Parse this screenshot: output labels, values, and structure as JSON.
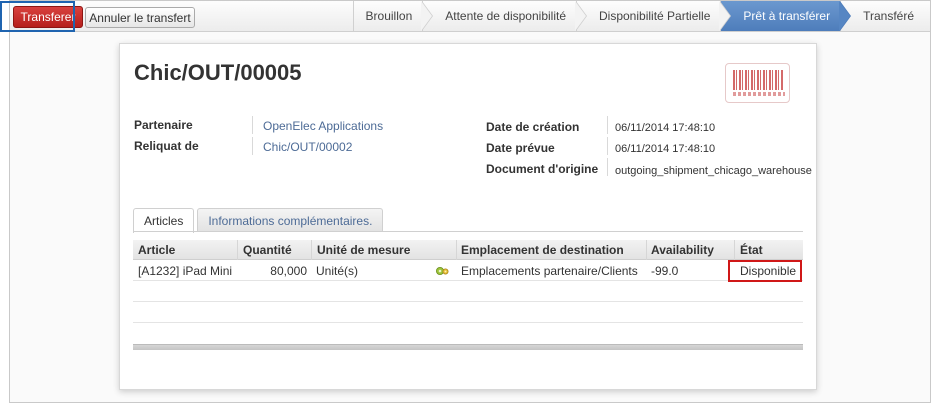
{
  "toolbar": {
    "transfer_label": "Transferer",
    "cancel_label": "Annuler le transfert"
  },
  "status_stages": [
    {
      "label": "Brouillon",
      "active": false
    },
    {
      "label": "Attente de disponibilité",
      "active": false
    },
    {
      "label": "Disponibilité Partielle",
      "active": false
    },
    {
      "label": "Prêt à transférer",
      "active": true
    },
    {
      "label": "Transféré",
      "active": false
    }
  ],
  "record": {
    "title": "Chic/OUT/00005",
    "partner_label": "Partenaire",
    "partner_value": "OpenElec Applications",
    "backorder_label": "Reliquat de",
    "backorder_value": "Chic/OUT/00002",
    "creation_date_label": "Date de création",
    "creation_date_value": "06/11/2014 17:48:10",
    "scheduled_date_label": "Date prévue",
    "scheduled_date_value": "06/11/2014 17:48:10",
    "source_doc_label": "Document d'origine",
    "source_doc_value": "outgoing_shipment_chicago_warehouse"
  },
  "tabs": [
    {
      "label": "Articles",
      "active": true
    },
    {
      "label": "Informations complémentaires.",
      "active": false
    }
  ],
  "table": {
    "headers": [
      "Article",
      "Quantité",
      "Unité de mesure",
      "Emplacement de destination",
      "Availability",
      "État"
    ],
    "rows": [
      {
        "article": "[A1232] iPad Mini",
        "quantity": "80,000",
        "uom": "Unité(s)",
        "destination": "Emplacements partenaire/Clients",
        "availability": "-99.0",
        "state": "Disponible"
      }
    ]
  },
  "colors": {
    "primary_button": "#c12a27",
    "active_stage": "#5686c3",
    "link": "#4d6b96",
    "highlight_blue": "#1f64b0",
    "highlight_red": "#d01818"
  }
}
